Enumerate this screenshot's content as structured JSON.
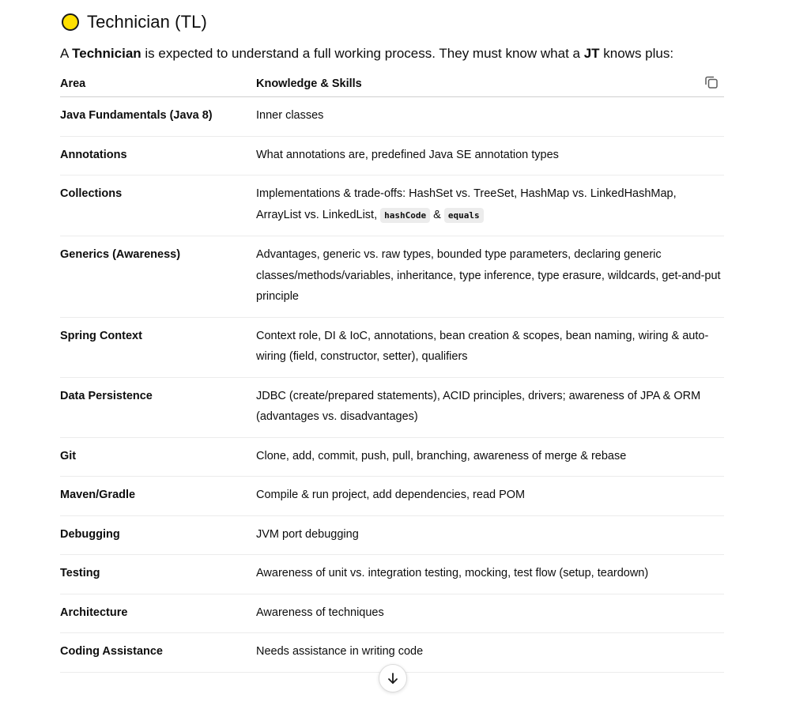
{
  "section": {
    "title": "Technician (TL)",
    "intro_prefix": "A ",
    "intro_role": "Technician",
    "intro_middle": " is expected to understand a full working process. They must know what a ",
    "intro_ref": "JT",
    "intro_suffix": " knows plus:"
  },
  "table": {
    "headers": [
      "Area",
      "Knowledge & Skills"
    ],
    "rows": [
      {
        "area": "Java Fundamentals (Java 8)",
        "skills": "Inner classes"
      },
      {
        "area": "Annotations",
        "skills": "What annotations are, predefined Java SE annotation types"
      },
      {
        "area": "Collections",
        "skills": "Implementations & trade-offs: HashSet vs. TreeSet, HashMap vs. LinkedHashMap, ArrayList vs. LinkedList, ",
        "code1": "hashCode",
        "amp": " & ",
        "code2": "equals"
      },
      {
        "area": "Generics (Awareness)",
        "skills": "Advantages, generic vs. raw types, bounded type parameters, declaring generic classes/methods/variables, inheritance, type inference, type erasure, wildcards, get-and-put principle"
      },
      {
        "area": "Spring Context",
        "skills": "Context role, DI & IoC, annotations, bean creation & scopes, bean naming, wiring & auto-wiring (field, constructor, setter), qualifiers"
      },
      {
        "area": "Data Persistence",
        "skills": "JDBC (create/prepared statements), ACID principles, drivers; awareness of JPA & ORM (advantages vs. disadvantages)"
      },
      {
        "area": "Git",
        "skills": "Clone, add, commit, push, pull, branching, awareness of merge & rebase"
      },
      {
        "area": "Maven/Gradle",
        "skills": "Compile & run project, add dependencies, read POM"
      },
      {
        "area": "Debugging",
        "skills": "JVM port debugging"
      },
      {
        "area": "Testing",
        "skills": "Awareness of unit vs. integration testing, mocking, test flow (setup, teardown)"
      },
      {
        "area": "Architecture",
        "skills": "Awareness of techniques"
      },
      {
        "area": "Coding Assistance",
        "skills": "Needs assistance in writing code"
      }
    ]
  },
  "icons": {
    "status": "yellow-circle-icon",
    "copy": "copy-icon",
    "scroll": "arrow-down-icon"
  },
  "colors": {
    "status_fill": "#ffe000"
  }
}
